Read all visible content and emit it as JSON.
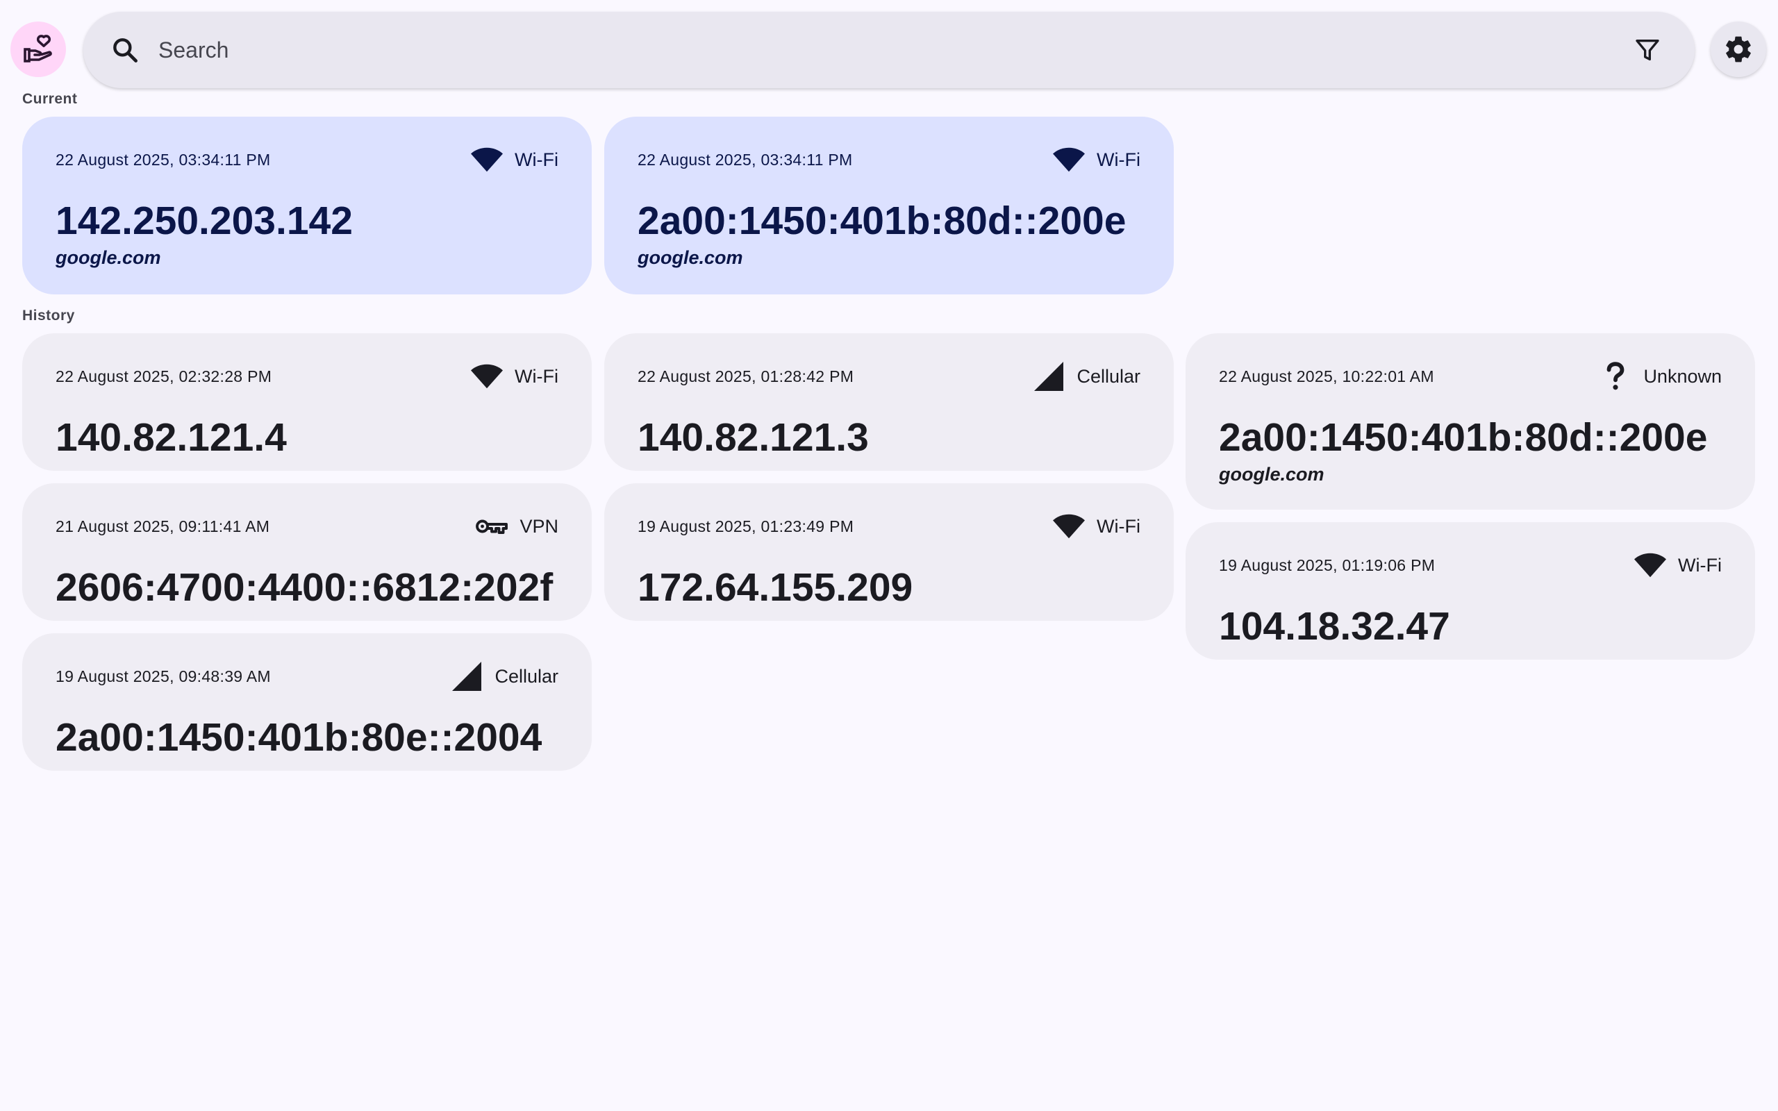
{
  "search": {
    "placeholder": "Search"
  },
  "sections": {
    "current_label": "Current",
    "history_label": "History"
  },
  "colors": {
    "background": "#faf8ff",
    "current_card": "#dce1ff",
    "history_card": "#efedf4",
    "logo_bg": "#ffd6f8"
  },
  "icons": {
    "logo": "hand-heart-icon",
    "search": "search-icon",
    "filter": "filter-icon",
    "settings": "gear-icon"
  },
  "current": [
    {
      "date": "22 August 2025, 03:34:11 PM",
      "network": "Wi-Fi",
      "network_icon": "wifi-icon",
      "ip": "142.250.203.142",
      "host": "google.com"
    },
    {
      "date": "22 August 2025, 03:34:11 PM",
      "network": "Wi-Fi",
      "network_icon": "wifi-icon",
      "ip": "2a00:1450:401b:80d::200e",
      "host": "google.com"
    }
  ],
  "history": [
    {
      "date": "22 August 2025, 02:32:28 PM",
      "network": "Wi-Fi",
      "network_icon": "wifi-icon",
      "ip": "140.82.121.4"
    },
    {
      "date": "22 August 2025, 01:28:42 PM",
      "network": "Cellular",
      "network_icon": "cellular-signal-icon",
      "ip": "140.82.121.3"
    },
    {
      "date": "22 August 2025, 10:22:01 AM",
      "network": "Unknown",
      "network_icon": "question-mark-icon",
      "ip": "2a00:1450:401b:80d::200e",
      "host": "google.com"
    },
    {
      "date": "21 August 2025, 09:11:41 AM",
      "network": "VPN",
      "network_icon": "vpn-key-icon",
      "ip": "2606:4700:4400::6812:202f"
    },
    {
      "date": "19 August 2025, 01:23:49 PM",
      "network": "Wi-Fi",
      "network_icon": "wifi-icon",
      "ip": "172.64.155.209"
    },
    {
      "date": "19 August 2025, 01:19:06 PM",
      "network": "Wi-Fi",
      "network_icon": "wifi-icon",
      "ip": "104.18.32.47"
    },
    {
      "date": "19 August 2025, 09:48:39 AM",
      "network": "Cellular",
      "network_icon": "cellular-signal-icon",
      "ip": "2a00:1450:401b:80e::2004"
    }
  ]
}
